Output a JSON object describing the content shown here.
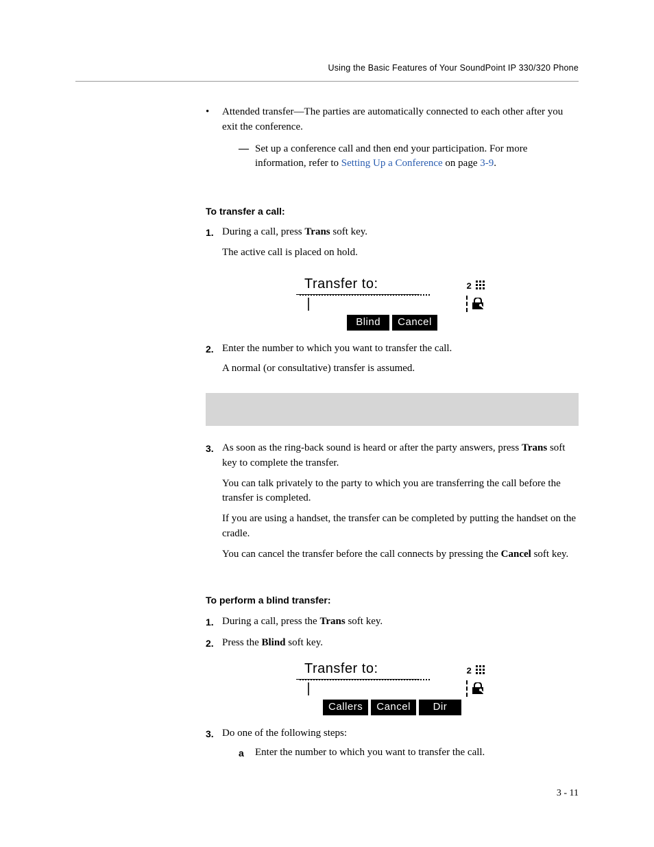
{
  "header": "Using the Basic Features of Your SoundPoint IP 330/320 Phone",
  "intro": {
    "bullet_label_start": "Attended transfer",
    "bullet_text": "—The parties are automatically connected to each other after you exit the conference.",
    "sub_dash": "—",
    "sub_text_before": "Set up a conference call and then end your participation. For more information, refer to ",
    "sub_link": "Setting Up a Conference",
    "sub_text_after": " on page ",
    "sub_page": "3-9",
    "sub_period": "."
  },
  "s1": {
    "heading": "To transfer a call:",
    "step1_num": "1.",
    "step1_a": "During a call, press ",
    "step1_bold": "Trans",
    "step1_b": " soft key.",
    "step1_note": "The active call is placed on hold.",
    "step2_num": "2.",
    "step2": "Enter the number to which you want to transfer the call.",
    "step2_note": "A normal (or consultative) transfer is assumed.",
    "step3_num": "3.",
    "step3_a": "As soon as the ring-back sound is heard or after the party answers, press ",
    "step3_bold": "Trans",
    "step3_b": " soft key to complete the transfer.",
    "step3_p1": "You can talk privately to the party to which you are transferring the call before the transfer is completed.",
    "step3_p2": "If you are using a handset, the transfer can be completed by putting the handset on the cradle.",
    "step3_p3a": "You can cancel the transfer before the call connects by pressing the ",
    "step3_p3bold": "Cancel",
    "step3_p3b": " soft key."
  },
  "s2": {
    "heading": "To perform a blind transfer:",
    "step1_num": "1.",
    "step1_a": "During a call, press the ",
    "step1_bold": "Trans",
    "step1_b": " soft key.",
    "step2_num": "2.",
    "step2_a": "Press the ",
    "step2_bold": "Blind",
    "step2_b": " soft key.",
    "step3_num": "3.",
    "step3": "Do one of the following steps:",
    "step3a_mark": "a",
    "step3a": "Enter the number to which you want to transfer the call."
  },
  "lcd1": {
    "title": "Transfer to:",
    "badge": "2",
    "cursor": "|",
    "k1": "Blind",
    "k2": "Cancel"
  },
  "lcd2": {
    "title": "Transfer to:",
    "badge": "2",
    "cursor": "|",
    "k1": "Callers",
    "k2": "Cancel",
    "k3": "Dir"
  },
  "footer": "3 - 11"
}
